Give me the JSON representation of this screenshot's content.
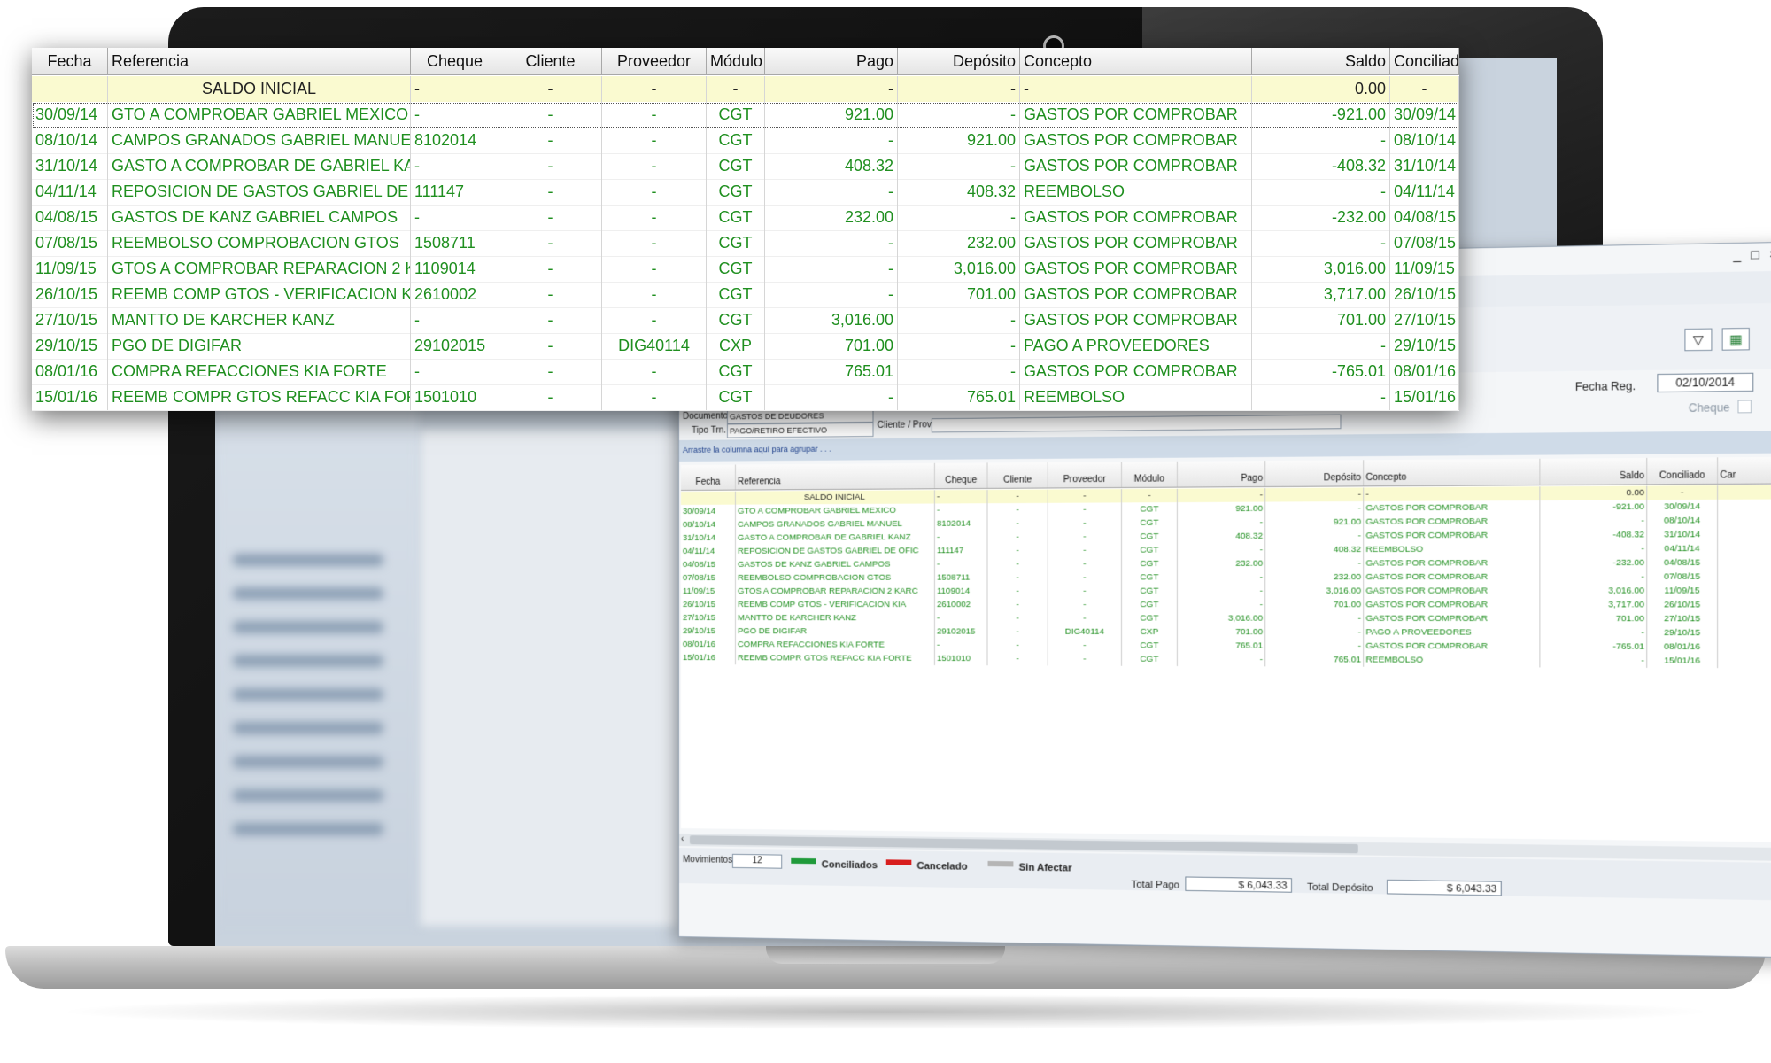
{
  "columns": [
    "Fecha",
    "Referencia",
    "Cheque",
    "Cliente",
    "Proveedor",
    "Módulo",
    "Pago",
    "Depósito",
    "Concepto",
    "Saldo",
    "Conciliado"
  ],
  "extra_column": "Car",
  "saldo_inicial": {
    "fecha": "",
    "referencia": "SALDO INICIAL",
    "cheque": "-",
    "cliente": "-",
    "proveedor": "-",
    "modulo": "-",
    "pago": "-",
    "deposito": "-",
    "concepto": "-",
    "saldo": "0.00",
    "conciliado": "-"
  },
  "rows": [
    {
      "fecha": "30/09/14",
      "referencia": "GTO A COMPROBAR GABRIEL MEXICO",
      "cheque": "-",
      "cliente": "-",
      "proveedor": "-",
      "modulo": "CGT",
      "pago": "921.00",
      "deposito": "-",
      "concepto": "GASTOS POR COMPROBAR",
      "saldo": "-921.00",
      "conciliado": "30/09/14"
    },
    {
      "fecha": "08/10/14",
      "referencia": "CAMPOS GRANADOS GABRIEL MANUEL",
      "cheque": "8102014",
      "cliente": "-",
      "proveedor": "-",
      "modulo": "CGT",
      "pago": "-",
      "deposito": "921.00",
      "concepto": "GASTOS POR COMPROBAR",
      "saldo": "-",
      "conciliado": "08/10/14"
    },
    {
      "fecha": "31/10/14",
      "referencia": "GASTO A COMPROBAR DE GABRIEL KANZ",
      "cheque": "-",
      "cliente": "-",
      "proveedor": "-",
      "modulo": "CGT",
      "pago": "408.32",
      "deposito": "-",
      "concepto": "GASTOS POR COMPROBAR",
      "saldo": "-408.32",
      "conciliado": "31/10/14"
    },
    {
      "fecha": "04/11/14",
      "referencia": "REPOSICION DE GASTOS GABRIEL DE OFIC",
      "cheque": "111147",
      "cliente": "-",
      "proveedor": "-",
      "modulo": "CGT",
      "pago": "-",
      "deposito": "408.32",
      "concepto": "REEMBOLSO",
      "saldo": "-",
      "conciliado": "04/11/14"
    },
    {
      "fecha": "04/08/15",
      "referencia": "GASTOS DE KANZ GABRIEL CAMPOS",
      "cheque": "-",
      "cliente": "-",
      "proveedor": "-",
      "modulo": "CGT",
      "pago": "232.00",
      "deposito": "-",
      "concepto": "GASTOS POR COMPROBAR",
      "saldo": "-232.00",
      "conciliado": "04/08/15"
    },
    {
      "fecha": "07/08/15",
      "referencia": "REEMBOLSO COMPROBACION GTOS",
      "cheque": "1508711",
      "cliente": "-",
      "proveedor": "-",
      "modulo": "CGT",
      "pago": "-",
      "deposito": "232.00",
      "concepto": "GASTOS POR COMPROBAR",
      "saldo": "-",
      "conciliado": "07/08/15"
    },
    {
      "fecha": "11/09/15",
      "referencia": "GTOS A COMPROBAR REPARACION 2 KARC",
      "cheque": "1109014",
      "cliente": "-",
      "proveedor": "-",
      "modulo": "CGT",
      "pago": "-",
      "deposito": "3,016.00",
      "concepto": "GASTOS POR COMPROBAR",
      "saldo": "3,016.00",
      "conciliado": "11/09/15"
    },
    {
      "fecha": "26/10/15",
      "referencia": "REEMB COMP GTOS - VERIFICACION KIA",
      "cheque": "2610002",
      "cliente": "-",
      "proveedor": "-",
      "modulo": "CGT",
      "pago": "-",
      "deposito": "701.00",
      "concepto": "GASTOS POR COMPROBAR",
      "saldo": "3,717.00",
      "conciliado": "26/10/15"
    },
    {
      "fecha": "27/10/15",
      "referencia": "MANTTO DE KARCHER KANZ",
      "cheque": "-",
      "cliente": "-",
      "proveedor": "-",
      "modulo": "CGT",
      "pago": "3,016.00",
      "deposito": "-",
      "concepto": "GASTOS POR COMPROBAR",
      "saldo": "701.00",
      "conciliado": "27/10/15"
    },
    {
      "fecha": "29/10/15",
      "referencia": "PGO DE DIGIFAR",
      "cheque": "29102015",
      "cliente": "-",
      "proveedor": "DIG40114",
      "modulo": "CXP",
      "pago": "701.00",
      "deposito": "-",
      "concepto": "PAGO A PROVEEDORES",
      "saldo": "-",
      "conciliado": "29/10/15"
    },
    {
      "fecha": "08/01/16",
      "referencia": "COMPRA REFACCIONES KIA FORTE",
      "cheque": "-",
      "cliente": "-",
      "proveedor": "-",
      "modulo": "CGT",
      "pago": "765.01",
      "deposito": "-",
      "concepto": "GASTOS POR COMPROBAR",
      "saldo": "-765.01",
      "conciliado": "08/01/16"
    },
    {
      "fecha": "15/01/16",
      "referencia": "REEMB COMPR GTOS REFACC KIA FORTE",
      "cheque": "1501010",
      "cliente": "-",
      "proveedor": "-",
      "modulo": "CGT",
      "pago": "-",
      "deposito": "765.01",
      "concepto": "REEMBOLSO",
      "saldo": "-",
      "conciliado": "15/01/16"
    }
  ],
  "window": {
    "controls": {
      "minimize": "_",
      "maximize": "□",
      "close": "×"
    },
    "fecha_reg_label": "Fecha Reg.",
    "fecha_reg_value": "02/10/2014",
    "cheque_label": "Cheque",
    "documento_label": "Documento",
    "documento_value": "GASTOS DE DEUDORES",
    "tipo_trn_label": "Tipo Trn.",
    "tipo_trn_value": "PAGO/RETIRO EFECTIVO",
    "cliente_prov_label": "Cliente / Prov",
    "group_hint": "Arrastre la columna aquí para agrupar . . .",
    "movimientos_label": "Movimientos",
    "movimientos_value": "12",
    "legend": [
      {
        "label": "Conciliados",
        "color": "#1f9a3a"
      },
      {
        "label": "Cancelado",
        "color": "#d81e1e"
      },
      {
        "label": "Sin Afectar",
        "color": "#b5b5b5"
      }
    ],
    "total_pago_label": "Total Pago",
    "total_pago_value": "$ 6,043.33",
    "total_deposito_label": "Total Depósito",
    "total_deposito_value": "$ 6,043.33",
    "filter_icon": "filter-icon",
    "excel_icon": "excel-icon"
  }
}
